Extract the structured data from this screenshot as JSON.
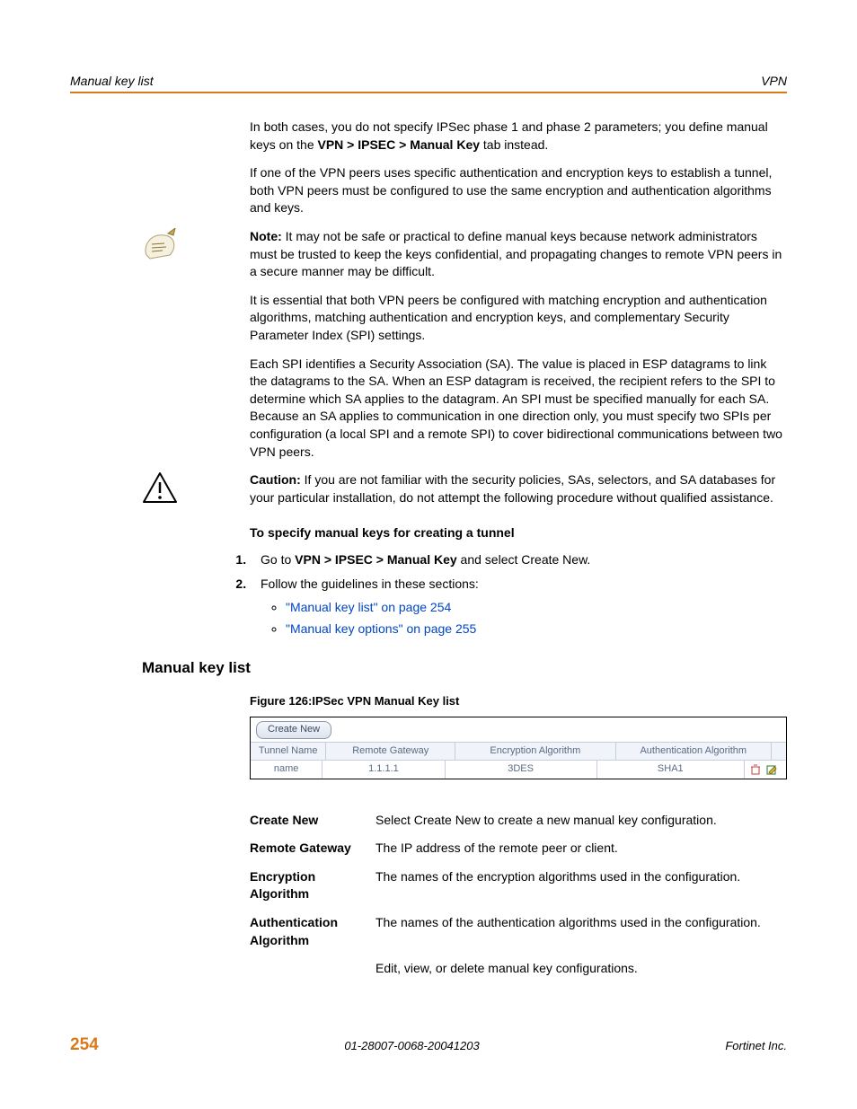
{
  "header": {
    "left": "Manual key list",
    "right": "VPN"
  },
  "paras": {
    "p1a": "In both cases, you do not specify IPSec phase 1 and phase 2 parameters; you define manual keys on the ",
    "p1b": "VPN > IPSEC > Manual Key",
    "p1c": " tab instead.",
    "p2": "If one of the VPN peers uses specific authentication and encryption keys to establish a tunnel, both VPN peers must be configured to use the same encryption and authentication algorithms and keys.",
    "note_label": "Note:",
    "note_body": " It may not be safe or practical to define manual keys because network administrators must be trusted to keep the keys confidential, and propagating changes to remote VPN peers in a secure manner may be difficult.",
    "p3": "It is essential that both VPN peers be configured with matching encryption and authentication algorithms, matching authentication and encryption keys, and complementary Security Parameter Index (SPI) settings.",
    "p4": "Each SPI identifies a Security Association (SA). The value is placed in ESP datagrams to link the datagrams to the SA. When an ESP datagram is received, the recipient refers to the SPI to determine which SA applies to the datagram. An SPI must be specified manually for each SA. Because an SA applies to communication in one direction only, you must specify two SPIs per configuration (a local SPI and a remote SPI) to cover bidirectional communications between two VPN peers.",
    "caution_label": "Caution:",
    "caution_body": " If you are not familiar with the security policies, SAs, selectors, and SA databases for your particular installation, do not attempt the following procedure without qualified assistance.",
    "subhead": "To specify manual keys for creating a tunnel",
    "step1a": "Go to ",
    "step1b": "VPN > IPSEC > Manual Key",
    "step1c": " and select Create New.",
    "step2": "Follow the guidelines in these sections:",
    "link1": "\"Manual key list\" on page 254",
    "link2": "\"Manual key options\" on page 255"
  },
  "section_head": "Manual key list",
  "figure_caption": "Figure 126:IPSec VPN Manual Key list",
  "figure": {
    "create_button": "Create New",
    "headers": {
      "c1": "Tunnel Name",
      "c2": "Remote Gateway",
      "c3": "Encryption Algorithm",
      "c4": "Authentication Algorithm"
    },
    "row": {
      "c1": "name",
      "c2": "1.1.1.1",
      "c3": "3DES",
      "c4": "SHA1"
    }
  },
  "desc": {
    "r1l": "Create New",
    "r1v": "Select Create New to create a new manual key configuration.",
    "r2l": "Remote Gateway",
    "r2v": "The IP address of the remote peer or client.",
    "r3l": "Encryption Algorithm",
    "r3v": "The names of the encryption algorithms used in the configuration.",
    "r4l": "Authentication Algorithm",
    "r4v": "The names of the authentication algorithms used in the configuration.",
    "r5v": "Edit, view, or delete manual key configurations."
  },
  "footer": {
    "page": "254",
    "docid": "01-28007-0068-20041203",
    "company": "Fortinet Inc."
  }
}
